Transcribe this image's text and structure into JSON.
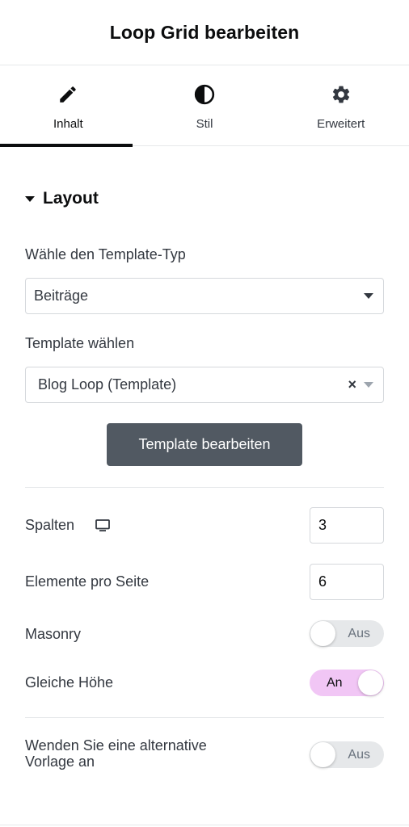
{
  "header": {
    "title": "Loop Grid bearbeiten"
  },
  "tabs": [
    {
      "label": "Inhalt",
      "icon": "pencil-icon",
      "active": true
    },
    {
      "label": "Stil",
      "icon": "half-circle-icon",
      "active": false
    },
    {
      "label": "Erweitert",
      "icon": "gear-icon",
      "active": false
    }
  ],
  "section": {
    "title": "Layout",
    "icon": "caret-down-icon"
  },
  "template_type": {
    "label": "Wähle den Template-Typ",
    "value": "Beiträge"
  },
  "template_select": {
    "label": "Template wählen",
    "value": "Blog Loop (Template)",
    "clear": "×"
  },
  "edit_button": {
    "label": "Template bearbeiten"
  },
  "columns": {
    "label": "Spalten",
    "device_icon": "desktop-icon",
    "value": "3"
  },
  "per_page": {
    "label": "Elemente pro Seite",
    "value": "6"
  },
  "masonry": {
    "label": "Masonry",
    "state": "Aus",
    "on": false
  },
  "equal_height": {
    "label": "Gleiche Höhe",
    "state": "An",
    "on": true
  },
  "alt_template": {
    "label_line1": "Wenden Sie eine alternative",
    "label_line2": "Vorlage an",
    "state": "Aus",
    "on": false
  },
  "colors": {
    "accent_toggle": "#f1c6f5",
    "button_bg": "#515962",
    "text": "#333840"
  }
}
